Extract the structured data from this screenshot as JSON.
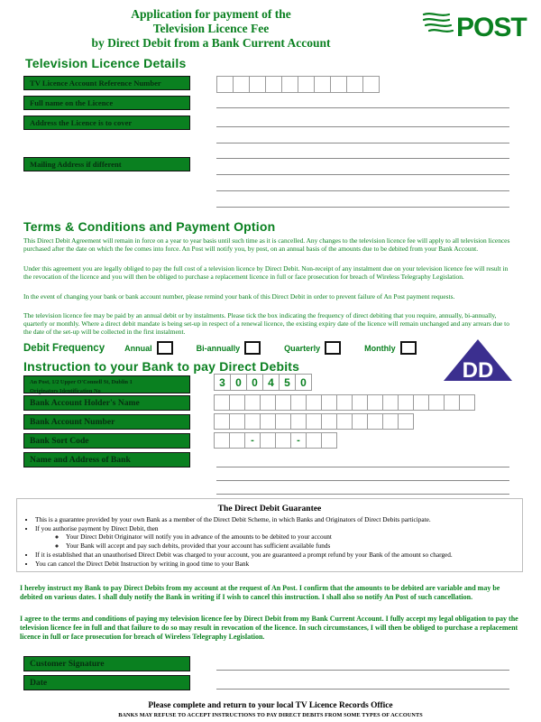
{
  "header": {
    "title_line1": "Application for payment of the",
    "title_line2": "Television Licence Fee",
    "title_line3": "by Direct Debit from a Bank Current Account",
    "logo_text": "POST",
    "logo_name": "an-post-logo"
  },
  "section_tv": {
    "heading": "Television Licence Details",
    "labels": {
      "ref_number": "TV Licence Account Reference Number",
      "full_name": "Full name on the Licence",
      "address": "Address the Licence is to cover",
      "mailing_address": "Mailing Address if different"
    },
    "ref_boxes": [
      "",
      "",
      "",
      "",
      "",
      "",
      "",
      "",
      "",
      ""
    ]
  },
  "section_terms": {
    "heading": "Terms & Conditions and Payment Option",
    "paragraphs": [
      "This Direct Debit Agreement will remain in force on a year to year basis until such time as it is cancelled.  Any changes to the television licence fee will apply to all television licences purchased after the date on which the fee comes into force.  An Post will notify you, by post, on an annual basis of the amounts due to be debited from your Bank Account.",
      "Under this agreement you are legally obliged to pay the full cost of a television licence by Direct Debit.  Non-receipt of any instalment due on your television licence fee will result in the revocation of the licence and you will then be obliged to purchase a replacement licence in full or face prosecution for breach of Wireless Telegraphy Legislation.",
      "In the event of changing your bank or bank account number, please remind your bank of this Direct Debit in order to prevent failure of An Post payment requests.",
      "The television licence fee may be paid by an annual debit or by instalments.  Please tick the box indicating the frequency of direct debiting that you require, annually, bi-annually, quarterly or monthly. Where a direct debit mandate is being set-up in respect of a renewal licence, the existing expiry date of the licence will remain unchanged and any arrears due to the date of the set-up will be collected in the first instalment."
    ],
    "frequency_label": "Debit Frequency",
    "frequency_options": [
      "Annual",
      "Bi-annually",
      "Quarterly",
      "Monthly"
    ]
  },
  "section_instruction": {
    "heading": "Instruction to your Bank to pay Direct Debits",
    "dd_logo_text": "DD",
    "labels": {
      "originator_line1": "An Post, 1/2 Upper O'Connell St, Dublin 1",
      "originator_line2": "Originators Identification No",
      "account_holder": "Bank Account Holder's Name",
      "account_number": "Bank Account Number",
      "sort_code": "Bank Sort Code",
      "bank_name_address": "Name and Address of Bank"
    },
    "originator_id": [
      "3",
      "0",
      "0",
      "4",
      "5",
      "0"
    ],
    "account_holder_boxes": 17,
    "account_number_boxes": 13,
    "sort_code_boxes": [
      "",
      "",
      "-",
      "",
      "",
      "-",
      "",
      ""
    ]
  },
  "guarantee": {
    "heading": "The Direct Debit Guarantee",
    "items": [
      "This is a guarantee provided by your own Bank as a member of the Direct Debit Scheme, in which Banks and Originators of Direct Debits participate.",
      "If you authorise payment by Direct Debit, then",
      "If it is established that an unauthorised Direct Debit was charged to your account, you are guaranteed a prompt refund by your Bank of the amount so charged.",
      "You can cancel the Direct Debit Instruction by writing in good time to your Bank"
    ],
    "sub_items": [
      "Your Direct Debit Originator will notify you in advance of the amounts to be debited to your account",
      "Your Bank will accept and pay such debits, provided that your account has sufficient available funds"
    ]
  },
  "declaration": {
    "paragraph1": "I hereby instruct my Bank to pay Direct Debits from my account at the request of An Post.  I confirm that the amounts to be debited are variable and may be debited on various dates.  I shall duly notify the Bank in writing if I wish to cancel this instruction. I shall also so notify An Post of such cancellation.",
    "paragraph2": "I agree to the terms and conditions of paying my television licence fee by Direct Debit from my Bank Current Account.  I fully accept my legal obligation to pay the television licence fee in full and that failure to do so may result in revocation of the licence.  In such circumstances, I will then be obliged to purchase a replacement licence in full or face prosecution for breach of Wireless Telegraphy Legislation.",
    "signature_label": "Customer Signature",
    "date_label": "Date"
  },
  "footer": {
    "main": "Please complete and return to your local TV Licence Records Office",
    "sub": "BANKS MAY REFUSE TO ACCEPT INSTRUCTIONS TO PAY DIRECT DEBITS FROM SOME TYPES OF ACCOUNTS"
  },
  "colors": {
    "green": "#0a8020",
    "dd_purple": "#3b2f8f",
    "box_border": "#9a9a9a"
  }
}
